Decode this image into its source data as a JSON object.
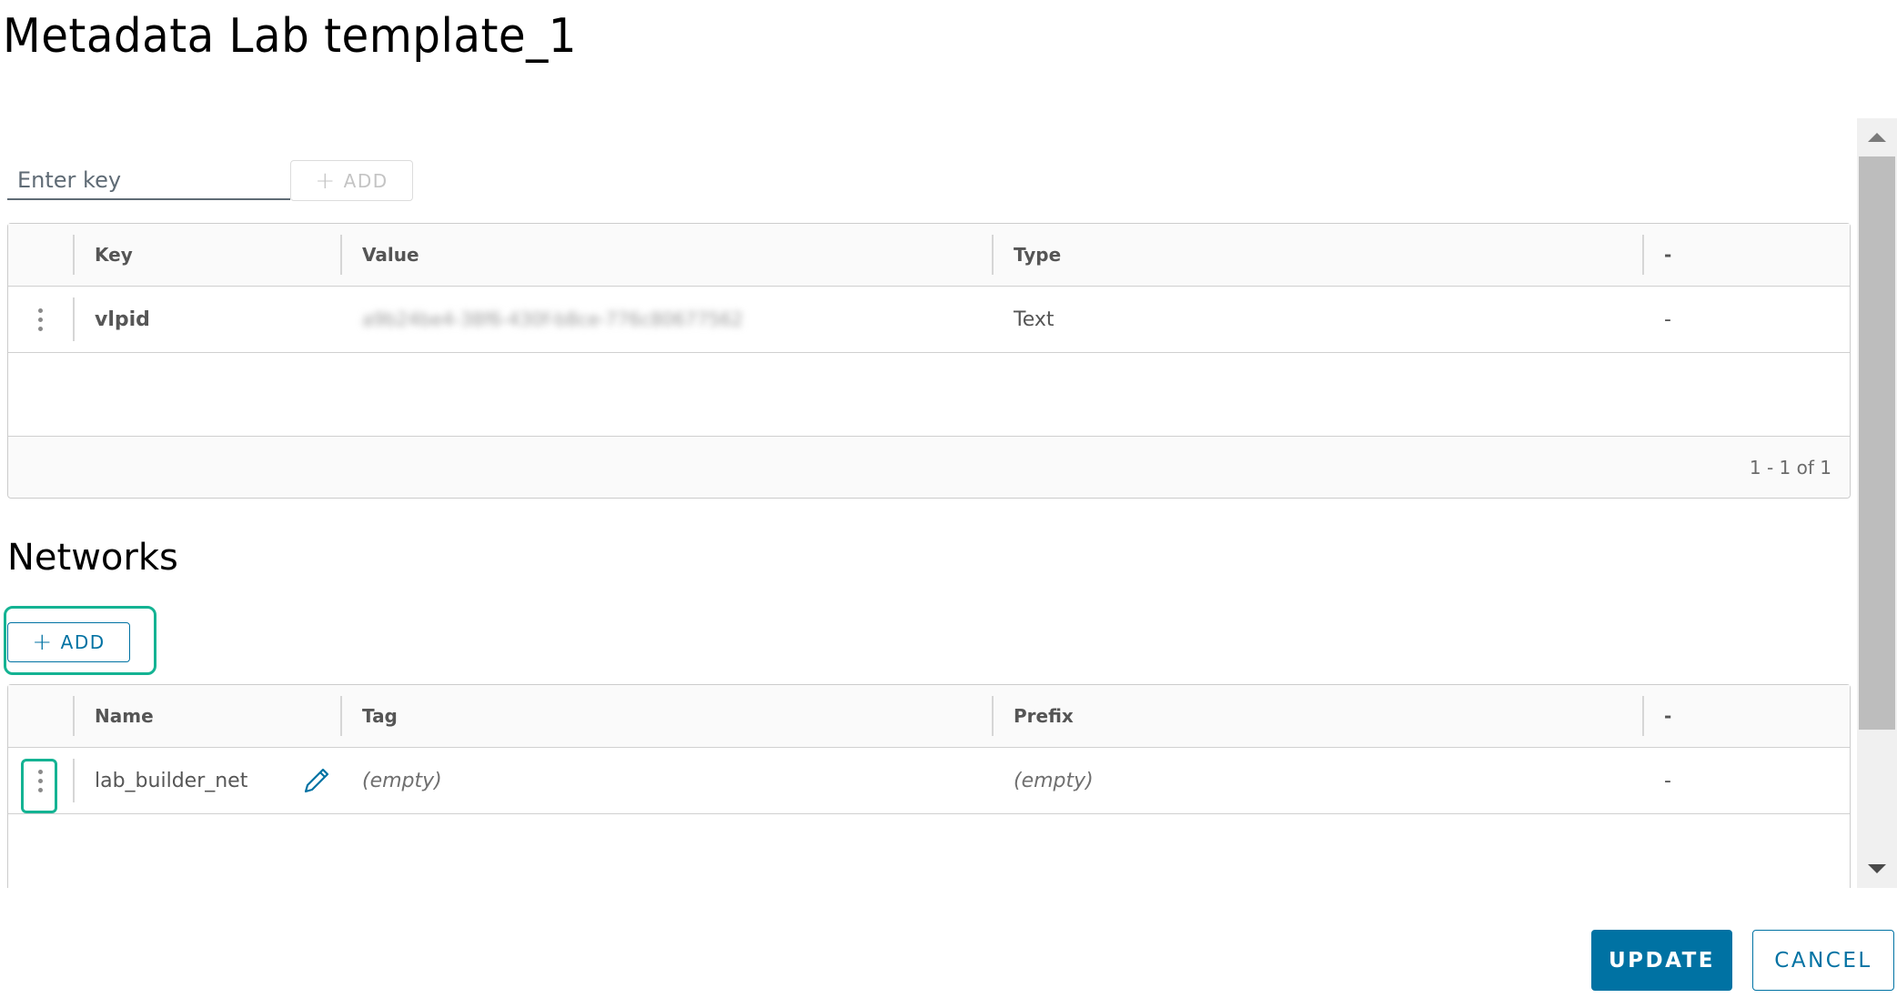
{
  "dialog": {
    "title": "Metadata Lab template_1"
  },
  "metadata": {
    "key_input_placeholder": "Enter key",
    "key_input_value": "",
    "add_button": {
      "icon": "plus-icon",
      "label": "+ ADD",
      "plus": "+",
      "text": "ADD",
      "disabled": true
    },
    "columns": [
      "Key",
      "Value",
      "Type",
      "-"
    ],
    "rows": [
      {
        "key": "vlpid",
        "value": "a9b24be4-38f6-430f-b8ce-776c80677562",
        "value_obscured": true,
        "type": "Text",
        "extra": "-"
      }
    ],
    "pagination": "1 - 1 of 1"
  },
  "networks": {
    "section_title": "Networks",
    "add_button": {
      "icon": "plus-icon",
      "plus": "+",
      "text": "ADD"
    },
    "columns": [
      "Name",
      "Tag",
      "Prefix",
      "-"
    ],
    "rows": [
      {
        "name": "lab_builder_net",
        "tag": "(empty)",
        "prefix": "(empty)",
        "extra": "-",
        "edit_icon": "pencil-icon"
      }
    ]
  },
  "footer": {
    "update_label": "UPDATE",
    "cancel_label": "CANCEL"
  },
  "colors": {
    "primary": "#0072a3",
    "focus": "#14b393",
    "border": "#cccccc",
    "header_bg": "#fafafa"
  }
}
